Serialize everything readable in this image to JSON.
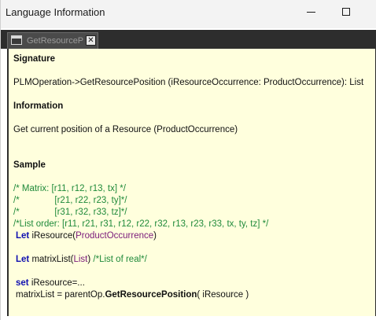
{
  "window": {
    "title": "Language Information",
    "minimize_symbol": "—",
    "maximize_symbol": "☐"
  },
  "tab": {
    "label": "GetResourceP",
    "close_symbol": "✕"
  },
  "doc": {
    "signature_heading": "Signature",
    "signature_text": "PLMOperation->GetResourcePosition (iResourceOccurrence: ProductOccurrence): List",
    "information_heading": "Information",
    "information_text": "Get current position of a Resource (ProductOccurrence)",
    "sample_heading": "Sample",
    "comment_line1": "/* Matrix: [r11, r12, r13, tx] */",
    "comment_line2": "/*              [r21, r22, r23, ty]*/",
    "comment_line3": "/*              [r31, r32, r33, tz]*/",
    "comment_line4": "/*List order: [r11, r21, r31, r12, r22, r32, r13, r23, r33, tx, ty, tz] */",
    "let1_keyword": "Let",
    "let1_var": " iResource(",
    "let1_type": "ProductOccurrence",
    "let1_end": ")",
    "let2_keyword": "Let",
    "let2_var": " matrixList(",
    "let2_type": "List",
    "let2_mid": ") ",
    "let2_comment": "/*List of real*/",
    "set_keyword": "set",
    "set_rest": " iResource=...",
    "assign_start": "matrixList = parentOp.",
    "assign_method": "GetResourcePosition",
    "assign_end": "( iResource )"
  }
}
